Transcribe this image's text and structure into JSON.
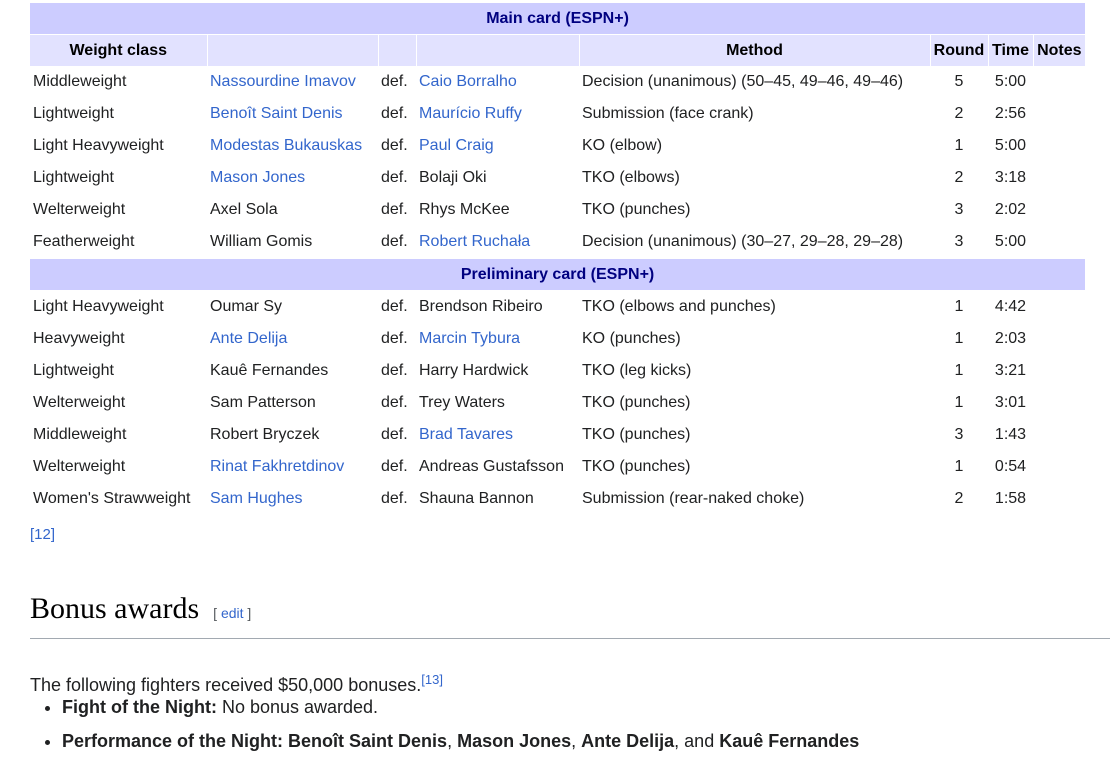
{
  "table": {
    "main_card_title": "Main card (ESPN+)",
    "prelim_card_title": "Preliminary card (ESPN+)",
    "columns": [
      "Weight class",
      "",
      "",
      "",
      "Method",
      "Round",
      "Time",
      "Notes"
    ],
    "def_label": "def.",
    "main_rows": [
      {
        "weight": "Middleweight",
        "winner": "Nassourdine Imavov",
        "winner_link": true,
        "loser": "Caio Borralho",
        "loser_link": true,
        "method": "Decision (unanimous) (50–45, 49–46, 49–46)",
        "round": "5",
        "time": "5:00",
        "notes": ""
      },
      {
        "weight": "Lightweight",
        "winner": "Benoît Saint Denis",
        "winner_link": true,
        "loser": "Maurício Ruffy",
        "loser_link": true,
        "method": "Submission (face crank)",
        "round": "2",
        "time": "2:56",
        "notes": ""
      },
      {
        "weight": "Light Heavyweight",
        "winner": "Modestas Bukauskas",
        "winner_link": true,
        "loser": "Paul Craig",
        "loser_link": true,
        "method": "KO (elbow)",
        "round": "1",
        "time": "5:00",
        "notes": ""
      },
      {
        "weight": "Lightweight",
        "winner": "Mason Jones",
        "winner_link": true,
        "loser": "Bolaji Oki",
        "loser_link": false,
        "method": "TKO (elbows)",
        "round": "2",
        "time": "3:18",
        "notes": ""
      },
      {
        "weight": "Welterweight",
        "winner": "Axel Sola",
        "winner_link": false,
        "loser": "Rhys McKee",
        "loser_link": false,
        "method": "TKO (punches)",
        "round": "3",
        "time": "2:02",
        "notes": ""
      },
      {
        "weight": "Featherweight",
        "winner": "William Gomis",
        "winner_link": false,
        "loser": "Robert Ruchała",
        "loser_link": true,
        "method": "Decision (unanimous) (30–27, 29–28, 29–28)",
        "round": "3",
        "time": "5:00",
        "notes": ""
      }
    ],
    "prelim_rows": [
      {
        "weight": "Light Heavyweight",
        "winner": "Oumar Sy",
        "winner_link": false,
        "loser": "Brendson Ribeiro",
        "loser_link": false,
        "method": "TKO (elbows and punches)",
        "round": "1",
        "time": "4:42",
        "notes": ""
      },
      {
        "weight": "Heavyweight",
        "winner": "Ante Delija",
        "winner_link": true,
        "loser": "Marcin Tybura",
        "loser_link": true,
        "method": "KO (punches)",
        "round": "1",
        "time": "2:03",
        "notes": ""
      },
      {
        "weight": "Lightweight",
        "winner": "Kauê Fernandes",
        "winner_link": false,
        "loser": "Harry Hardwick",
        "loser_link": false,
        "method": "TKO (leg kicks)",
        "round": "1",
        "time": "3:21",
        "notes": ""
      },
      {
        "weight": "Welterweight",
        "winner": "Sam Patterson",
        "winner_link": false,
        "loser": "Trey Waters",
        "loser_link": false,
        "method": "TKO (punches)",
        "round": "1",
        "time": "3:01",
        "notes": ""
      },
      {
        "weight": "Middleweight",
        "winner": "Robert Bryczek",
        "winner_link": false,
        "loser": "Brad Tavares",
        "loser_link": true,
        "method": "TKO (punches)",
        "round": "3",
        "time": "1:43",
        "notes": ""
      },
      {
        "weight": "Welterweight",
        "winner": "Rinat Fakhretdinov",
        "winner_link": true,
        "loser": "Andreas Gustafsson",
        "loser_link": false,
        "method": "TKO (punches)",
        "round": "1",
        "time": "0:54",
        "notes": ""
      },
      {
        "weight": "Women's Strawweight",
        "winner": "Sam Hughes",
        "winner_link": true,
        "loser": "Shauna Bannon",
        "loser_link": false,
        "method": "Submission (rear-naked choke)",
        "round": "2",
        "time": "1:58",
        "notes": ""
      }
    ]
  },
  "reference": "[12]",
  "bonus": {
    "heading": "Bonus awards",
    "edit_open": "[",
    "edit_label": "edit",
    "edit_close": "]",
    "intro": "The following fighters received $50,000 bonuses.",
    "intro_ref": "[13]",
    "fotn_label": "Fight of the Night:",
    "fotn_text": " No bonus awarded.",
    "potn_label": "Performance of the Night:",
    "potn_names": [
      "Benoît Saint Denis",
      "Mason Jones",
      "Ante Delija",
      "Kauê Fernandes"
    ],
    "sep_comma": ", ",
    "sep_and": ", and "
  },
  "colors": {
    "link": "#3366cc",
    "section_bg": "#ccccff",
    "section_text": "#000080",
    "header_bg": "#e2e2ff"
  }
}
